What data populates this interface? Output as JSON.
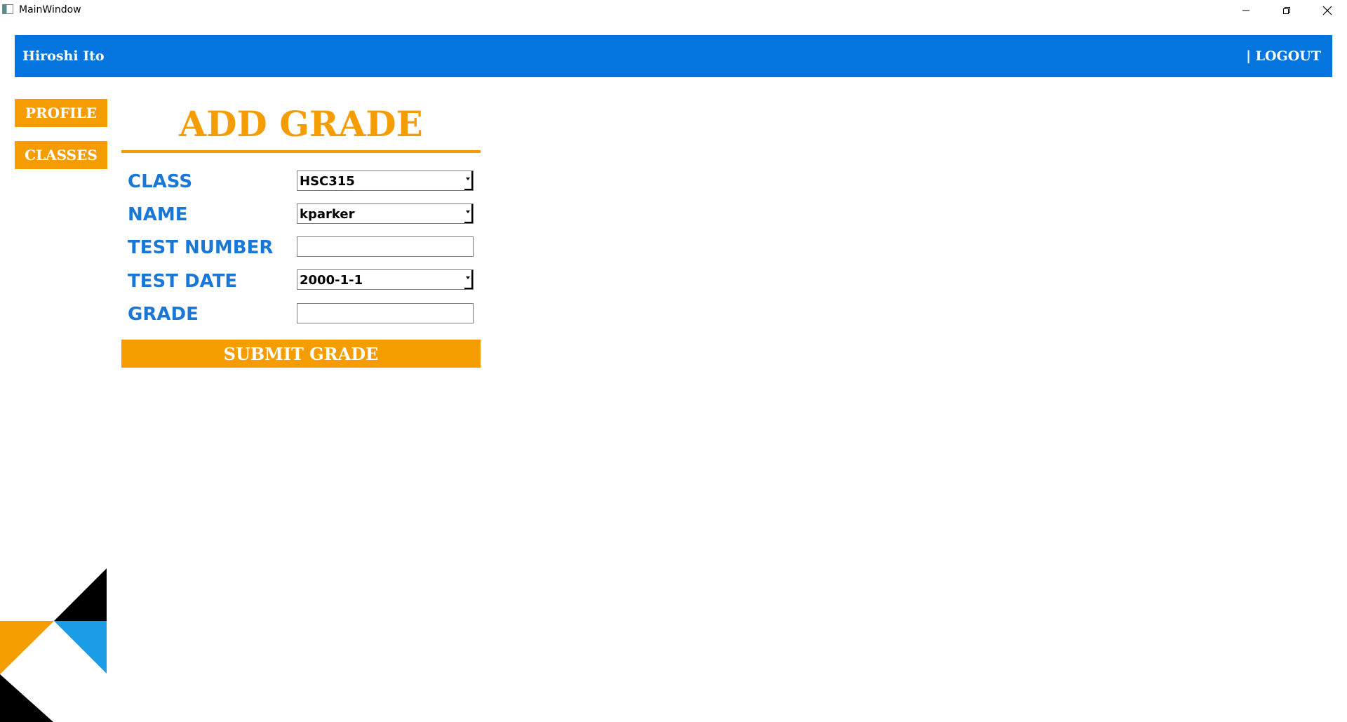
{
  "window": {
    "title": "MainWindow"
  },
  "header": {
    "user_name": "Hiroshi Ito",
    "logout_label": "| LOGOUT"
  },
  "sidebar": {
    "items": [
      {
        "label": "PROFILE"
      },
      {
        "label": "CLASSES"
      }
    ]
  },
  "form": {
    "title": "ADD GRADE",
    "fields": {
      "class": {
        "label": "CLASS",
        "value": "HSC315"
      },
      "name": {
        "label": "NAME",
        "value": "kparker"
      },
      "test_number": {
        "label": "TEST NUMBER",
        "value": ""
      },
      "test_date": {
        "label": "TEST DATE",
        "value": "2000-1-1"
      },
      "grade": {
        "label": "GRADE",
        "value": ""
      }
    },
    "submit_label": "SUBMIT GRADE"
  },
  "colors": {
    "header_blue": "#0475df",
    "accent_orange": "#f59c00",
    "label_blue": "#1a77d6",
    "deco_blue": "#1d9ce6",
    "deco_black": "#000000"
  },
  "icons": {
    "app": "app-icon",
    "minimize": "minimize-icon",
    "restore": "restore-icon",
    "close": "close-icon",
    "dropdown": "chevron-down-icon"
  }
}
